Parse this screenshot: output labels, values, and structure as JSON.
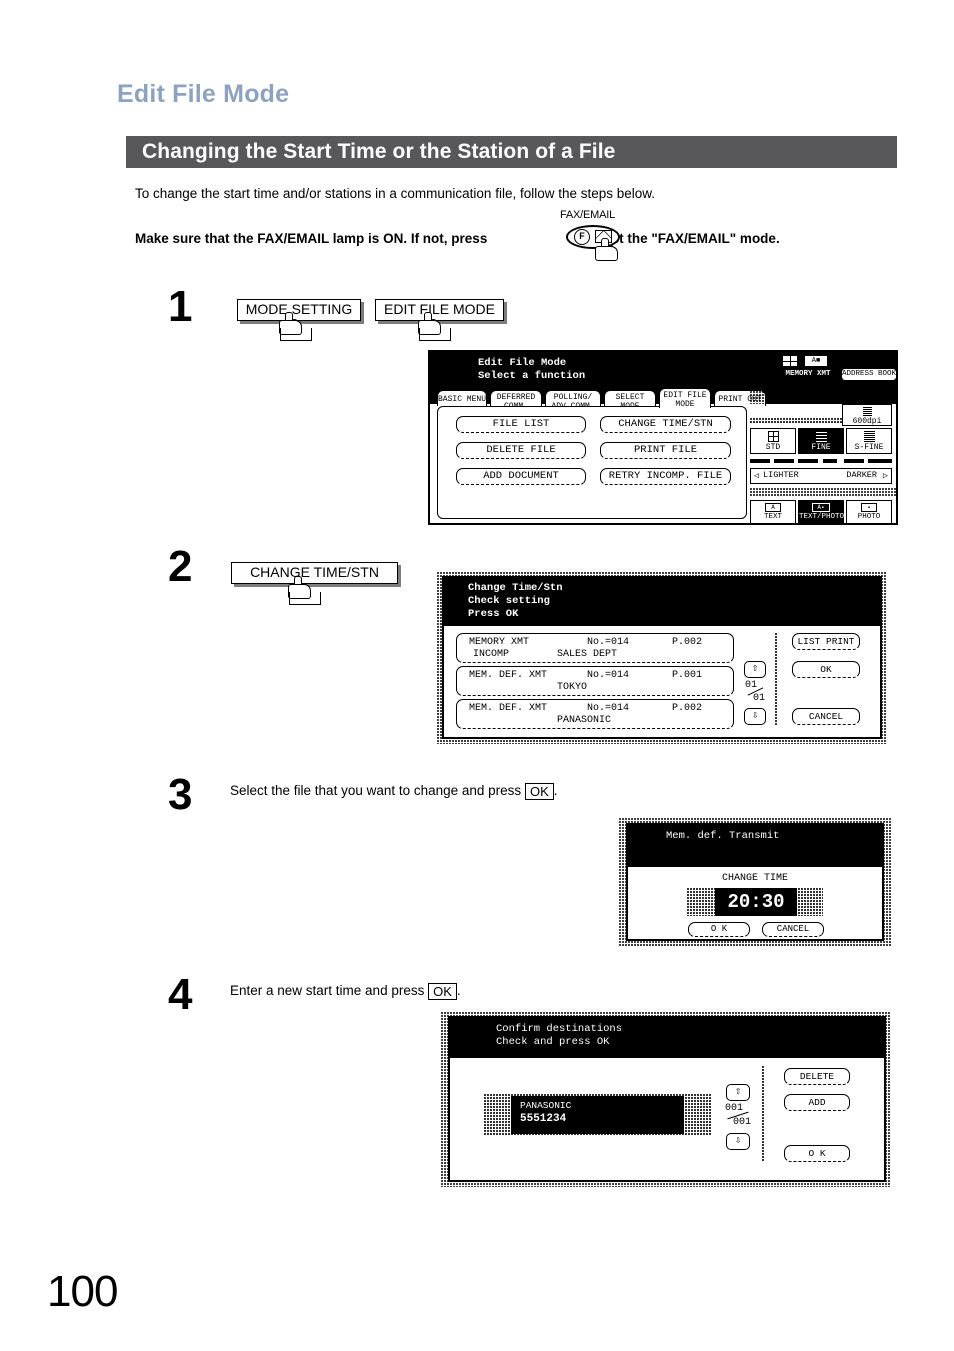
{
  "document": {
    "chapter_title": "Edit File Mode",
    "section_title": "Changing the Start Time or the Station of a File",
    "intro": "To change the start time and/or stations in a communication file, follow the steps below.",
    "lamp_note_part1": "Make sure that the FAX/EMAIL lamp is ON.  If not, press",
    "lamp_note_part2": "to select the \"FAX/EMAIL\" mode.",
    "fax_key_label": "FAX/EMAIL",
    "page_number": "100",
    "colors": {
      "chapter_title": "#8da3bd",
      "section_bar": "#58585a",
      "section_text": "#ffffff",
      "keycap_shadow": "#7d7d7d"
    }
  },
  "step1": {
    "number": "1",
    "keys": [
      {
        "label": "MODE SETTING"
      },
      {
        "label": "EDIT FILE MODE"
      }
    ],
    "lcd": {
      "title_line1": "Edit File Mode",
      "title_line2": "Select a function",
      "tabs": [
        {
          "label_line1": "BASIC MENU",
          "label_line2": "",
          "selected": false
        },
        {
          "label_line1": "DEFERRED",
          "label_line2": "COMM.",
          "selected": false
        },
        {
          "label_line1": "POLLING/",
          "label_line2": "ADV.COMM.",
          "selected": false
        },
        {
          "label_line1": "SELECT",
          "label_line2": "MODE",
          "selected": false
        },
        {
          "label_line1": "EDIT FILE",
          "label_line2": "MODE",
          "selected": true
        },
        {
          "label_line1": "PRINT OUT",
          "label_line2": "",
          "selected": false
        }
      ],
      "buttons_left": [
        {
          "label": "FILE LIST"
        },
        {
          "label": "DELETE FILE"
        },
        {
          "label": "ADD DOCUMENT"
        }
      ],
      "buttons_right": [
        {
          "label": "CHANGE TIME/STN"
        },
        {
          "label": "PRINT FILE"
        },
        {
          "label": "RETRY INCOMP. FILE"
        }
      ],
      "status": {
        "memory_xmt": "MEMORY XMT",
        "address_book": "ADDRESS BOOK"
      },
      "resolution": {
        "dpi": "600dpi",
        "options": [
          {
            "label": "STD",
            "selected": false
          },
          {
            "label": "FINE",
            "selected": true
          },
          {
            "label": "S-FINE",
            "selected": false
          }
        ]
      },
      "contrast": {
        "lighter": "LIGHTER",
        "darker": "DARKER"
      },
      "original": [
        {
          "label": "TEXT",
          "selected": false
        },
        {
          "label": "TEXT/PHOTO",
          "selected": true
        },
        {
          "label": "PHOTO",
          "selected": false
        }
      ]
    }
  },
  "step2": {
    "number": "2",
    "keys": [
      {
        "label": "CHANGE TIME/STN"
      }
    ],
    "lcd": {
      "title_line1": "Change Time/Stn",
      "title_line2": "Check setting",
      "title_line3": "Press OK",
      "files": [
        {
          "type": "MEMORY XMT",
          "no": "No.=014",
          "pages": "P.002",
          "sub_left": "INCOMP",
          "station": "SALES DEPT"
        },
        {
          "type": "MEM. DEF. XMT",
          "no": "No.=014",
          "pages": "P.001",
          "sub_left": "",
          "station": "TOKYO"
        },
        {
          "type": "MEM. DEF. XMT",
          "no": "No.=014",
          "pages": "P.002",
          "sub_left": "",
          "station": "PANASONIC"
        }
      ],
      "scroll": {
        "current": "01",
        "total": "01"
      },
      "buttons": [
        {
          "label": "LIST PRINT"
        },
        {
          "label": "OK"
        },
        {
          "label": "CANCEL"
        }
      ]
    }
  },
  "step3": {
    "number": "3",
    "instruction_before": "Select the file that you want to change and press",
    "instruction_key": "OK",
    "instruction_after": ".",
    "lcd": {
      "title": "Mem. def. Transmit",
      "field_label": "CHANGE TIME",
      "field_value": "20:30",
      "buttons": [
        {
          "label": "O K"
        },
        {
          "label": "CANCEL"
        }
      ]
    }
  },
  "step4": {
    "number": "4",
    "instruction_before": "Enter a new start time and press",
    "instruction_key": "OK",
    "instruction_after": ".",
    "lcd": {
      "title_line1": "Confirm destinations",
      "title_line2": "Check and press OK",
      "destination": {
        "name": "PANASONIC",
        "number": "5551234"
      },
      "scroll": {
        "current": "001",
        "total": "001"
      },
      "buttons": [
        {
          "label": "DELETE"
        },
        {
          "label": "ADD"
        },
        {
          "label": "O K"
        }
      ]
    }
  }
}
